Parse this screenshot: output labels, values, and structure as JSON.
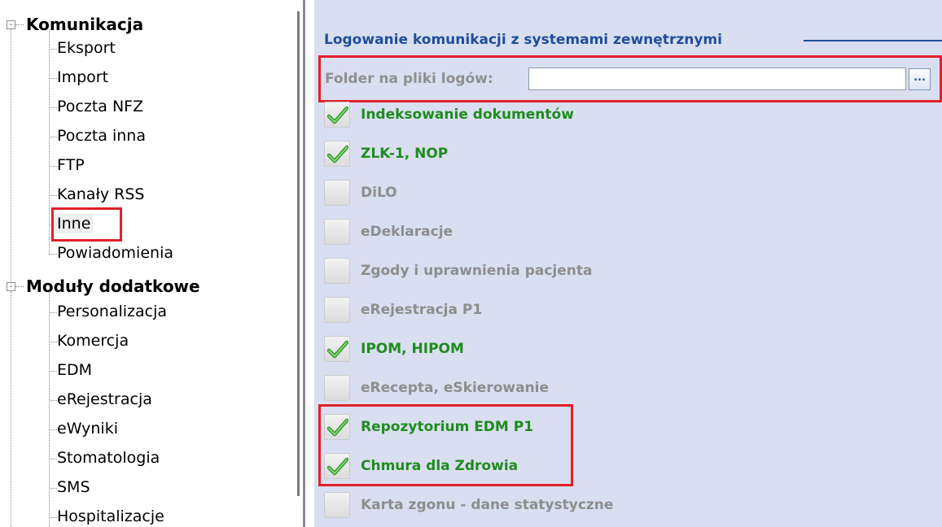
{
  "tree": {
    "group1": {
      "label": "Komunikacja",
      "toggle": "-",
      "items": [
        "Eksport",
        "Import",
        "Poczta NFZ",
        "Poczta inna",
        "FTP",
        "Kanały RSS",
        "Inne",
        "Powiadomienia"
      ],
      "selected": "Inne"
    },
    "group2": {
      "label": "Moduły dodatkowe",
      "toggle": "-",
      "items": [
        "Personalizacja",
        "Komercja",
        "EDM",
        "eRejestracja",
        "eWyniki",
        "Stomatologia",
        "SMS",
        "Hospitalizacje"
      ]
    }
  },
  "panel": {
    "group_title": "Logowanie komunikacji z systemami zewnętrznymi",
    "folder_label": "Folder na pliki logów:",
    "folder_value": "",
    "browse_label": "...",
    "checkboxes": [
      {
        "label": "Indeksowanie dokumentów",
        "checked": true
      },
      {
        "label": "ZLK-1, NOP",
        "checked": true
      },
      {
        "label": "DiLO",
        "checked": false
      },
      {
        "label": "eDeklaracje",
        "checked": false
      },
      {
        "label": "Zgody i uprawnienia pacjenta",
        "checked": false
      },
      {
        "label": "eRejestracja P1",
        "checked": false
      },
      {
        "label": "IPOM, HIPOM",
        "checked": true
      },
      {
        "label": "eRecepta, eSkierowanie",
        "checked": false
      },
      {
        "label": "Repozytorium EDM P1",
        "checked": true
      },
      {
        "label": "Chmura dla Zdrowia",
        "checked": true
      },
      {
        "label": "Karta zgonu - dane statystyczne",
        "checked": false
      }
    ]
  },
  "colors": {
    "highlight": "#e0202a",
    "checked_text": "#1e8c1e",
    "unchecked_text": "#8d8d8d",
    "group_title": "#1d4e9e",
    "panel_bg": "#d9dff0"
  },
  "icons": {
    "expanded_toggle": "minus-box-icon",
    "checkmark": "green-checkmark-icon"
  }
}
